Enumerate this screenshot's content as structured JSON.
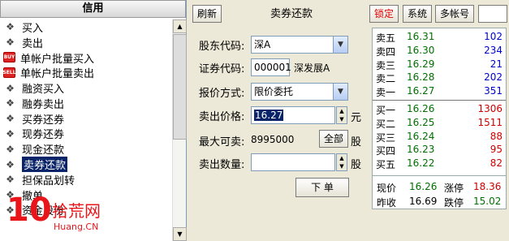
{
  "left_panel": {
    "header": "信用",
    "items": [
      {
        "label": "买入",
        "icon": "diamond"
      },
      {
        "label": "卖出",
        "icon": "diamond"
      },
      {
        "label": "单帐户批量买入",
        "icon": "buy"
      },
      {
        "label": "单帐户批量卖出",
        "icon": "sell"
      },
      {
        "label": "融资买入",
        "icon": "diamond"
      },
      {
        "label": "融券卖出",
        "icon": "diamond"
      },
      {
        "label": "买券还券",
        "icon": "diamond"
      },
      {
        "label": "现券还券",
        "icon": "diamond"
      },
      {
        "label": "现金还款",
        "icon": "diamond"
      },
      {
        "label": "卖券还款",
        "icon": "diamond",
        "selected": true
      },
      {
        "label": "担保品划转",
        "icon": "diamond"
      },
      {
        "label": "撤单",
        "icon": "diamond"
      },
      {
        "label": "资金股份",
        "icon": "diamond"
      }
    ],
    "icon_glyphs": {
      "buy": "BUY",
      "sell": "SELL"
    }
  },
  "toolbar": {
    "refresh": "刷新",
    "title": "卖券还款",
    "lock": "锁定",
    "system": "系统",
    "multi_account": "多帐号"
  },
  "form": {
    "shareholder_label": "股东代码:",
    "shareholder_value": "深A",
    "code_label": "证券代码:",
    "code_value": "000001",
    "code_name": "深发展A",
    "quote_mode_label": "报价方式:",
    "quote_mode_value": "限价委托",
    "price_label": "卖出价格:",
    "price_value": "16.27",
    "price_unit": "元",
    "max_label": "最大可卖:",
    "max_value": "8995000",
    "all_button": "全部",
    "max_unit": "股",
    "qty_label": "卖出数量:",
    "qty_value": "",
    "qty_unit": "股",
    "submit": "下 单"
  },
  "quote": {
    "sell": [
      {
        "name": "卖五",
        "price": "16.31",
        "vol": "102"
      },
      {
        "name": "卖四",
        "price": "16.30",
        "vol": "234"
      },
      {
        "name": "卖三",
        "price": "16.29",
        "vol": "21"
      },
      {
        "name": "卖二",
        "price": "16.28",
        "vol": "202"
      },
      {
        "name": "卖一",
        "price": "16.27",
        "vol": "351"
      }
    ],
    "buy": [
      {
        "name": "买一",
        "price": "16.26",
        "vol": "1306"
      },
      {
        "name": "买二",
        "price": "16.25",
        "vol": "1511"
      },
      {
        "name": "买三",
        "price": "16.24",
        "vol": "88"
      },
      {
        "name": "买四",
        "price": "16.23",
        "vol": "95"
      },
      {
        "name": "买五",
        "price": "16.22",
        "vol": "82"
      }
    ],
    "sell_vol_color": "#0000cc",
    "buy_vol_color": "#cc0000"
  },
  "stats": {
    "now_label": "现价",
    "now_value": "16.26",
    "limit_up_label": "涨停",
    "limit_up_value": "18.36",
    "prev_close_label": "昨收",
    "prev_close_value": "16.69",
    "limit_down_label": "跌停",
    "limit_down_value": "15.02"
  },
  "watermark": {
    "num": "10",
    "cn": "拾荒网",
    "site": "Huang.CN"
  }
}
